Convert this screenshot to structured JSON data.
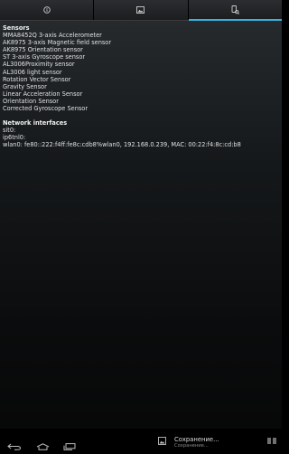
{
  "tabs": [
    {
      "icon": "info-icon",
      "selected": false
    },
    {
      "icon": "image-icon",
      "selected": false
    },
    {
      "icon": "device-sensor-icon",
      "selected": true
    }
  ],
  "sensors": {
    "heading": "Sensors",
    "items": [
      "MMA8452Q 3-axis Accelerometer",
      "AK8975 3-axis Magnetic field sensor",
      "AK8975 Orientation sensor",
      "ST 3-axis Gyroscope sensor",
      "AL3006Proximity sensor",
      "AL3006 light sensor",
      "Rotation Vector Sensor",
      "Gravity Sensor",
      "Linear Acceleration Sensor",
      "Orientation Sensor",
      "Corrected Gyroscope Sensor"
    ]
  },
  "network": {
    "heading": "Network interfaces",
    "items": [
      "sit0:",
      "ip6tnl0:",
      "wlan0: fe80::222:f4ff:fe8c:cdb8%wlan0, 192.168.0.239, MAC: 00:22:f4:8c:cd:b8"
    ]
  },
  "navbar": {
    "buttons": [
      "back-icon",
      "home-icon",
      "recent-apps-icon"
    ]
  },
  "notification": {
    "title": "Сохранение...",
    "subtitle": "Сохранение..."
  },
  "colors": {
    "accent": "#33b5e5",
    "background": "#000000"
  }
}
